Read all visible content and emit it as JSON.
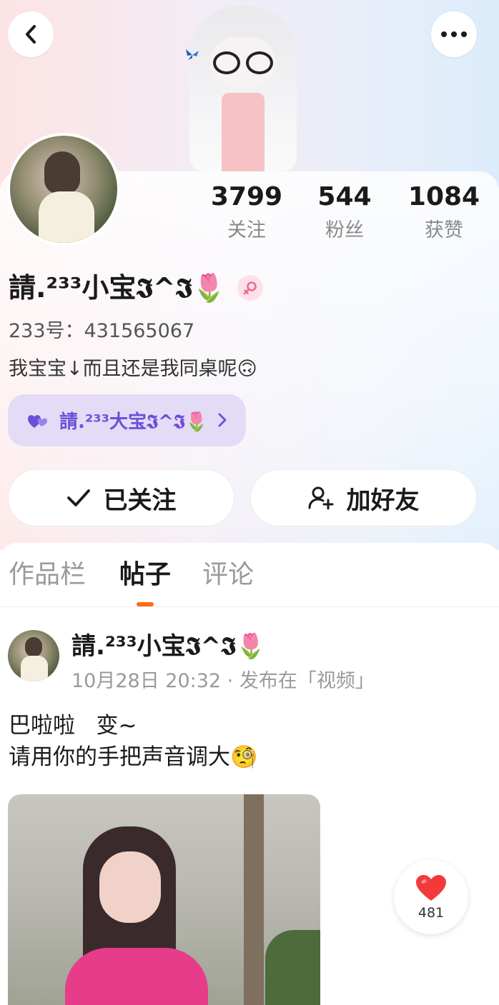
{
  "profile": {
    "username": "請.²³³小宝𝕴^𝕴🌷",
    "uid_text": "233号：431565067",
    "bio": "我宝宝↓而且还是我同桌呢🙃",
    "gender_icon": "female-icon"
  },
  "stats": [
    {
      "value": "3799",
      "label": "关注"
    },
    {
      "value": "544",
      "label": "粉丝"
    },
    {
      "value": "1084",
      "label": "获赞"
    }
  ],
  "relation_pill": {
    "icon": "double-heart-icon",
    "label": "請.²³³大宝𝕴^𝕴🌷"
  },
  "actions": {
    "follow_label": "已关注",
    "add_friend_label": "加好友"
  },
  "tabs": [
    {
      "label": "作品栏"
    },
    {
      "label": "帖子"
    },
    {
      "label": "评论"
    }
  ],
  "post": {
    "author": "請.²³³小宝𝕴^𝕴🌷",
    "meta": "10月28日 20:32 · 发布在「视频」",
    "line1": "巴啦啦   变~",
    "line2": "请用你的手把声音调大🧐",
    "like_count": "481"
  },
  "colors": {
    "accent_orange": "#ff6b1a",
    "pill_text": "#6c4fd8",
    "like_red": "#f23a3a"
  }
}
